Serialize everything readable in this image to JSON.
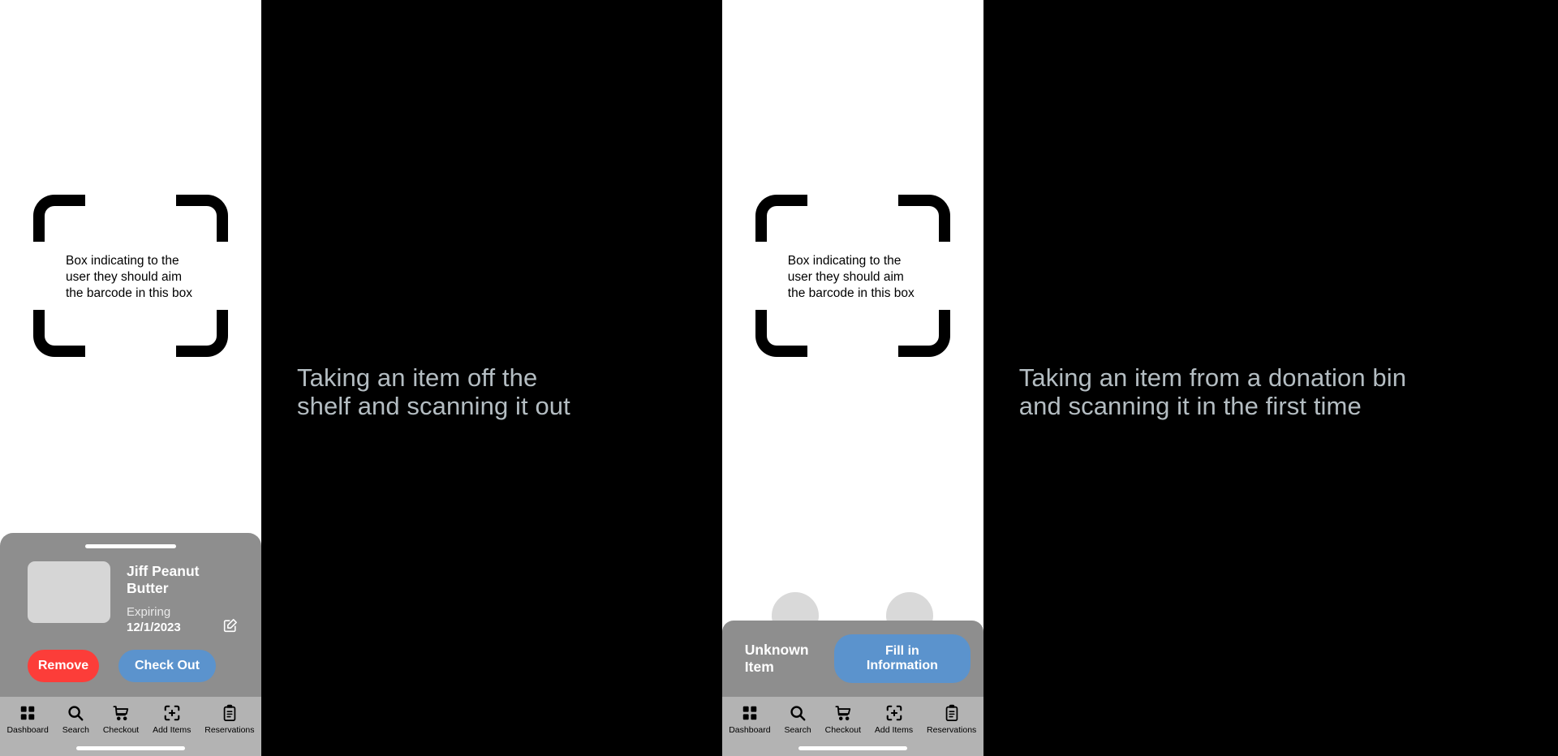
{
  "panels": {
    "scanner_checkout": {
      "viewfinder_caption": "Box indicating to the\nuser they should aim\nthe barcode in this box",
      "sheet": {
        "item_name": "Jiff Peanut Butter",
        "expiry_label": "Expiring",
        "expiry_date": "12/1/2023",
        "edit_icon": "edit-square-pencil-icon",
        "remove_label": "Remove",
        "checkout_label": "Check Out"
      }
    },
    "scanner_unknown": {
      "viewfinder_caption": "Box indicating to the\nuser they should aim\nthe barcode in this box",
      "bar": {
        "unknown_label": "Unknown Item",
        "fill_label": "Fill in Information"
      }
    }
  },
  "annotations": {
    "checkout_note": "Taking an item off the\nshelf and scanning it out",
    "donation_note": "Taking an item from a donation bin\nand scanning it in the first time"
  },
  "tabbar": {
    "items": [
      {
        "label": "Dashboard",
        "icon": "grid-squares-icon"
      },
      {
        "label": "Search",
        "icon": "magnifier-icon"
      },
      {
        "label": "Checkout",
        "icon": "shopping-cart-icon"
      },
      {
        "label": "Add Items",
        "icon": "scan-plus-icon"
      },
      {
        "label": "Reservations",
        "icon": "clipboard-list-icon"
      }
    ]
  },
  "colors": {
    "sheet_background": "#8e8e8e",
    "tabbar_background": "#b3b3b3",
    "remove_button": "#fc3d39",
    "primary_button": "#5b93cd",
    "note_text": "#b4bdc2",
    "thumbnail": "#d6d6d6"
  }
}
